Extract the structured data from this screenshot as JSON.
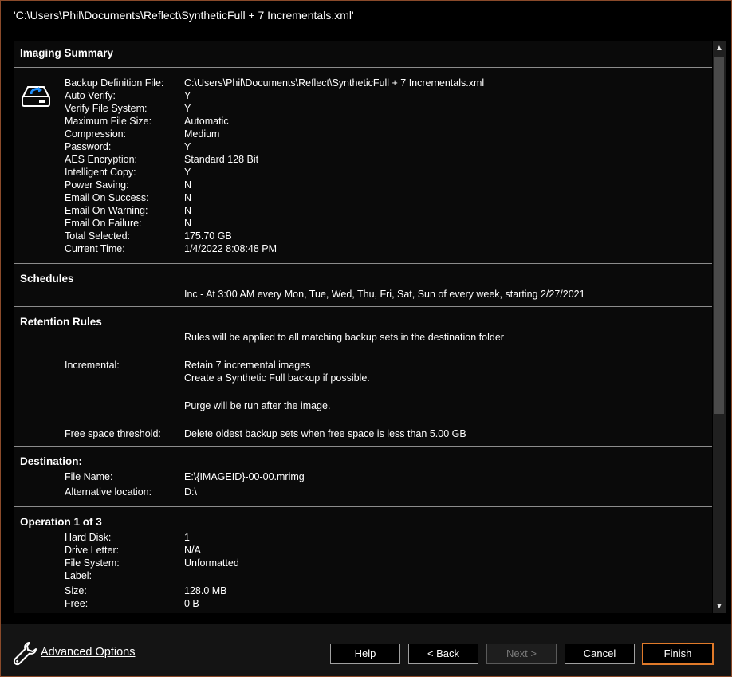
{
  "window": {
    "title": "'C:\\Users\\Phil\\Documents\\Reflect\\SyntheticFull + 7 Incrementals.xml'"
  },
  "imaging_summary": {
    "heading": "Imaging Summary",
    "icon": "drive-backup-icon",
    "rows": [
      {
        "label": "Backup Definition File:",
        "value": "C:\\Users\\Phil\\Documents\\Reflect\\SyntheticFull + 7 Incrementals.xml"
      },
      {
        "label": "Auto Verify:",
        "value": "Y"
      },
      {
        "label": "Verify File System:",
        "value": "Y"
      },
      {
        "label": "Maximum File Size:",
        "value": "Automatic"
      },
      {
        "label": "Compression:",
        "value": "Medium"
      },
      {
        "label": "Password:",
        "value": "Y"
      },
      {
        "label": "AES Encryption:",
        "value": "Standard 128 Bit"
      },
      {
        "label": "Intelligent Copy:",
        "value": "Y"
      },
      {
        "label": "Power Saving:",
        "value": "N"
      },
      {
        "label": "Email On Success:",
        "value": "N"
      },
      {
        "label": "Email On Warning:",
        "value": "N"
      },
      {
        "label": "Email On Failure:",
        "value": "N"
      },
      {
        "label": "Total Selected:",
        "value": "175.70 GB"
      },
      {
        "label": "Current Time:",
        "value": "1/4/2022 8:08:48 PM"
      }
    ]
  },
  "schedules": {
    "heading": "Schedules",
    "text": "Inc - At 3:00 AM every Mon, Tue, Wed, Thu, Fri, Sat, Sun of every week, starting 2/27/2021"
  },
  "retention": {
    "heading": "Retention Rules",
    "note": "Rules will be applied to all matching backup sets in the destination folder",
    "incremental_label": "Incremental:",
    "incremental_line1": "Retain 7 incremental images",
    "incremental_line2": "Create a Synthetic Full backup if possible.",
    "purge": "Purge will be run after the image.",
    "free_label": "Free space threshold:",
    "free_value": "Delete oldest backup sets when free space is less than 5.00 GB"
  },
  "destination": {
    "heading": "Destination:",
    "rows": [
      {
        "label": "File Name:",
        "value": "E:\\{IMAGEID}-00-00.mrimg"
      },
      {
        "label": "Alternative location:",
        "value": "D:\\"
      }
    ]
  },
  "operation": {
    "heading": "Operation 1 of 3",
    "rows": [
      {
        "label": "Hard Disk:",
        "value": "1"
      },
      {
        "label": "Drive Letter:",
        "value": "N/A"
      },
      {
        "label": "File System:",
        "value": "Unformatted"
      },
      {
        "label": "Label:",
        "value": ""
      },
      {
        "label": "Size:",
        "value": "128.0 MB"
      },
      {
        "label": "Free:",
        "value": "0 B"
      }
    ]
  },
  "footer": {
    "advanced_options": "Advanced Options",
    "buttons": {
      "help": "Help",
      "back": "< Back",
      "next": "Next >",
      "cancel": "Cancel",
      "finish": "Finish"
    }
  },
  "colors": {
    "accent": "#e07a2a",
    "icon_blue": "#1e90ff"
  }
}
